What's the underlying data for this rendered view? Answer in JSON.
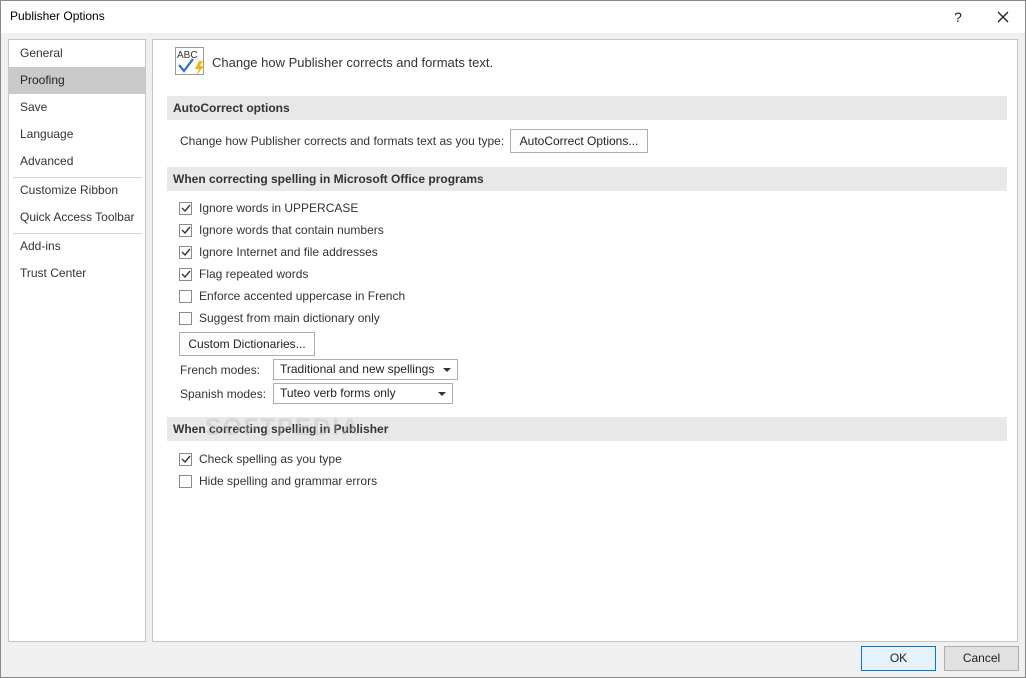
{
  "window": {
    "title": "Publisher Options",
    "help_glyph": "?"
  },
  "sidebar": {
    "items": [
      {
        "label": "General"
      },
      {
        "label": "Proofing",
        "active": true
      },
      {
        "label": "Save"
      },
      {
        "label": "Language"
      },
      {
        "label": "Advanced"
      },
      {
        "label": "Customize Ribbon"
      },
      {
        "label": "Quick Access Toolbar"
      },
      {
        "label": "Add-ins"
      },
      {
        "label": "Trust Center"
      }
    ]
  },
  "main": {
    "header_icon_text": "ABC",
    "header_text": "Change how Publisher corrects and formats text.",
    "autocorrect": {
      "section_title": "AutoCorrect options",
      "description": "Change how Publisher corrects and formats text as you type:",
      "button_label": "AutoCorrect Options..."
    },
    "office_spelling": {
      "section_title": "When correcting spelling in Microsoft Office programs",
      "options": [
        {
          "label": "Ignore words in UPPERCASE",
          "checked": true
        },
        {
          "label": "Ignore words that contain numbers",
          "checked": true
        },
        {
          "label": "Ignore Internet and file addresses",
          "checked": true
        },
        {
          "label": "Flag repeated words",
          "checked": true
        },
        {
          "label": "Enforce accented uppercase in French",
          "checked": false
        },
        {
          "label": "Suggest from main dictionary only",
          "checked": false
        }
      ],
      "custom_dict_button": "Custom Dictionaries...",
      "french_modes_label": "French modes:",
      "french_modes_value": "Traditional and new spellings",
      "spanish_modes_label": "Spanish modes:",
      "spanish_modes_value": "Tuteo verb forms only"
    },
    "publisher_spelling": {
      "section_title": "When correcting spelling in Publisher",
      "options": [
        {
          "label": "Check spelling as you type",
          "checked": true
        },
        {
          "label": "Hide spelling and grammar errors",
          "checked": false
        }
      ]
    },
    "watermark": "SOFTPEDIA"
  },
  "footer": {
    "ok_label": "OK",
    "cancel_label": "Cancel"
  },
  "colors": {
    "active_nav": "#c9c9c9",
    "section_bg": "#e8e8e8",
    "ok_border": "#0078d7"
  }
}
